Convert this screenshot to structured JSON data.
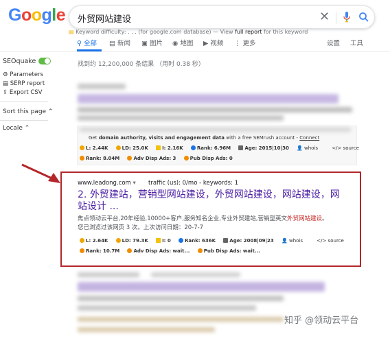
{
  "logo": {
    "text_parts": [
      "G",
      "o",
      "o",
      "g",
      "l",
      "e"
    ]
  },
  "search": {
    "query": "外贸网站建设",
    "clear_icon": "close-icon",
    "mic_icon": "mic-icon",
    "search_icon": "search-icon"
  },
  "keyword_difficulty": {
    "label": "Keyword difficulty:",
    "value": ". . .",
    "db_note": "(for google.com database) — View",
    "report_link": "full report",
    "tail": "for this keyword"
  },
  "tabs": [
    {
      "label": "全部",
      "icon": "search-icon",
      "active": true
    },
    {
      "label": "新闻",
      "icon": "news-icon",
      "active": false
    },
    {
      "label": "图片",
      "icon": "image-icon",
      "active": false
    },
    {
      "label": "地图",
      "icon": "map-pin-icon",
      "active": false
    },
    {
      "label": "视频",
      "icon": "video-icon",
      "active": false
    },
    {
      "label": "更多",
      "icon": "more-icon",
      "active": false
    },
    {
      "label": "设置",
      "icon": "",
      "active": false
    },
    {
      "label": "工具",
      "icon": "",
      "active": false
    }
  ],
  "stats": "找到约 12,200,000 条结果 （用时 0.38 秒）",
  "sidebar": {
    "seoquake": "SEOquake",
    "items": [
      {
        "label": "Parameters",
        "icon": "gear-icon"
      },
      {
        "label": "SERP report",
        "icon": "list-icon"
      },
      {
        "label": "Export CSV",
        "icon": "export-icon"
      }
    ],
    "sort": "Sort this page ⌃",
    "locale": "Locale ⌃"
  },
  "seo_row_1": {
    "promo_prefix": "Get",
    "promo_bold": "domain authority, visits and engagement data",
    "promo_mid": "with a free SEMrush account -",
    "promo_link": "Connect",
    "l": "L: 2.44K",
    "ld": "LD: 25.0K",
    "i": "I: 2.16K",
    "rank": "Rank: 6.96M",
    "age": "Age: 2015|10|30",
    "whois": "whois",
    "source": "source",
    "rank2": "Rank: 8.04M",
    "adv": "Adv Disp Ads: 3",
    "pub": "Pub Disp Ads: 0"
  },
  "result": {
    "url": "www.leadong.com",
    "url_caret": "▾",
    "traffic": "traffic (us): 0/mo - keywords: 1",
    "number": "2.",
    "title": "外贸建站，营销型网站建设，外贸网站建设，网站建设，网站设计 ...",
    "desc_main": "焦点领动云平台,20年经验,10000+客户,服务知名企业,专业外贸建站,营销型英文",
    "desc_hl": "外贸网站建设",
    "desc_end": "。",
    "visited": "您已浏览过该网页 3 次。上次访问日期：20-7-7",
    "l": "L: 2.64K",
    "ld": "LD: 79.3K",
    "i": "I: 0",
    "rank": "Rank: 636K",
    "age": "Age: 2008|09|23",
    "whois": "whois",
    "source": "source",
    "rank2": "Rank: 10.7M",
    "adv": "Adv Disp Ads: wait...",
    "pub": "Pub Disp Ads: wait..."
  },
  "watermark": "知乎 @领动云平台",
  "colors": {
    "accent": "#1a73e8",
    "visited_title": "#4b1ea4",
    "frame": "#b3262a",
    "arrow": "#b3262a"
  }
}
